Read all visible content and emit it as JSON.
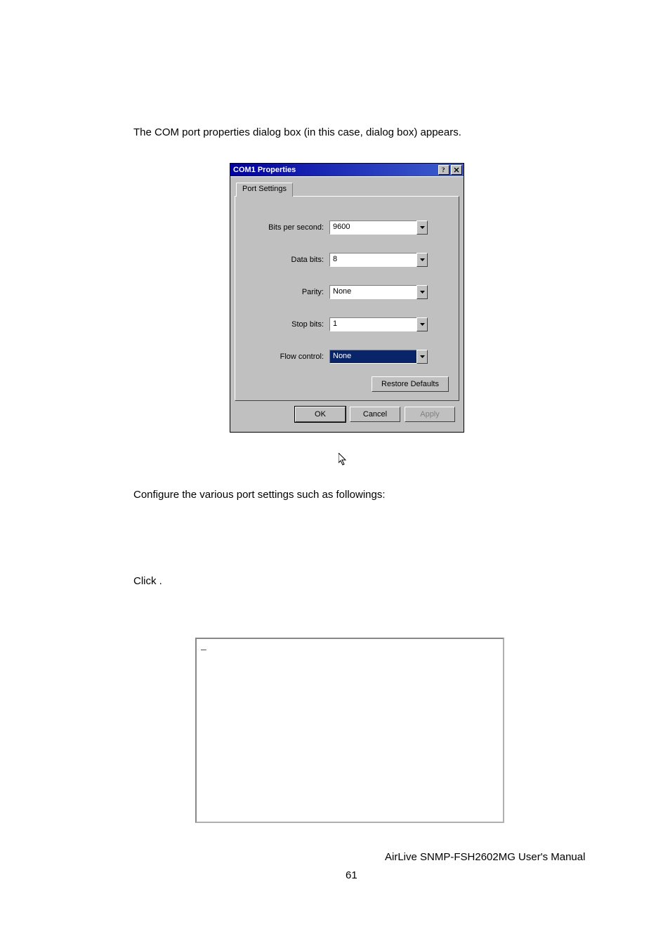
{
  "intro_full": "The COM port properties dialog box (in this case,                                 dialog box) appears.",
  "dialog": {
    "title": "COM1 Properties",
    "tab_label": "Port Settings",
    "fields": {
      "bps": {
        "label": "Bits per second:",
        "value": "9600"
      },
      "data": {
        "label": "Data bits:",
        "value": "8"
      },
      "parity": {
        "label": "Parity:",
        "value": "None"
      },
      "stop": {
        "label": "Stop bits:",
        "value": "1"
      },
      "flow": {
        "label": "Flow control:",
        "value": "None"
      }
    },
    "restore_label": "Restore Defaults",
    "ok_label": "OK",
    "cancel_label": "Cancel",
    "apply_label": "Apply"
  },
  "after1": "Configure the various port settings such as followings:",
  "after2": "Click       .",
  "inset_dash": "–",
  "footer_right": "AirLive SNMP-FSH2602MG User's Manual",
  "footer_page": "61"
}
